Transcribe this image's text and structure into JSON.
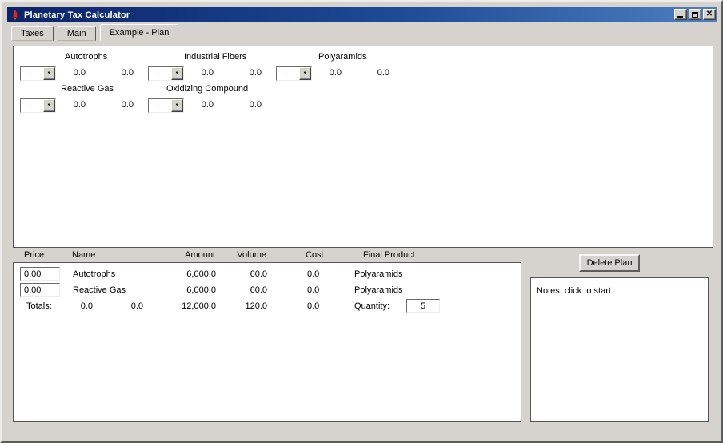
{
  "window": {
    "title": "Planetary Tax Calculator"
  },
  "icons": {
    "app": "rocket-icon",
    "minimize": "minimize-bar",
    "maximize": "maximize-square",
    "close": "✕",
    "dropdown": "▼"
  },
  "tabs": [
    {
      "label": "Taxes",
      "active": false
    },
    {
      "label": "Main",
      "active": false
    },
    {
      "label": "Example - Plan",
      "active": true
    }
  ],
  "plan": {
    "row1": [
      {
        "label": "Autotrophs",
        "selected": "→",
        "v1": "0.0",
        "v2": "0.0"
      },
      {
        "label": "Industrial Fibers",
        "selected": "→",
        "v1": "0.0",
        "v2": "0.0"
      },
      {
        "label": "Polyaramids",
        "selected": "→",
        "v1": "0.0",
        "v2": "0.0"
      }
    ],
    "row2": [
      {
        "label": "Reactive Gas",
        "selected": "→",
        "v1": "0.0",
        "v2": "0.0"
      },
      {
        "label": "Oxidizing Compound",
        "selected": "→",
        "v1": "0.0",
        "v2": "0.0"
      }
    ]
  },
  "table": {
    "headers": [
      "Price",
      "Name",
      "Amount",
      "Volume",
      "Cost",
      "Final Product"
    ],
    "rows": [
      {
        "price": "0.00",
        "name": "Autotrophs",
        "amount": "6,000.0",
        "volume": "60.0",
        "cost": "0.0",
        "final_product": "Polyaramids"
      },
      {
        "price": "0.00",
        "name": "Reactive Gas",
        "amount": "6,000.0",
        "volume": "60.0",
        "cost": "0.0",
        "final_product": "Polyaramids"
      }
    ],
    "totals": {
      "label": "Totals:",
      "price_total": "0.0",
      "extra": "0.0",
      "amount": "12,000.0",
      "volume": "120.0",
      "cost": "0.0"
    },
    "quantity": {
      "label": "Quantity:",
      "value": "5"
    }
  },
  "buttons": {
    "delete_plan": "Delete Plan"
  },
  "notes": {
    "text": "Notes: click to start"
  }
}
